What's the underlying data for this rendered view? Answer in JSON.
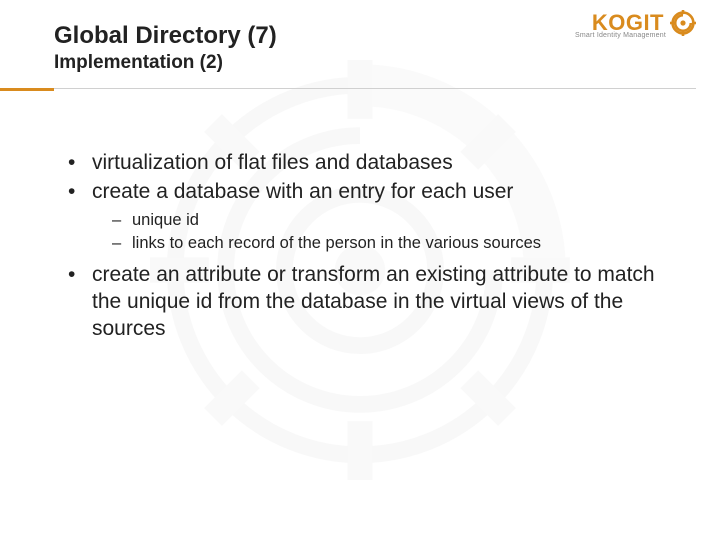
{
  "brand": {
    "name": "KOGIT",
    "tagline": "Smart Identity Management",
    "accent": "#d98b1e"
  },
  "header": {
    "title": "Global Directory (7)",
    "subtitle": "Implementation (2)"
  },
  "bullets": [
    {
      "text": "virtualization of flat files and databases"
    },
    {
      "text": "create a database with an entry for each user",
      "sub": [
        {
          "text": "unique id"
        },
        {
          "text": "links to each record of the person in the various sources"
        }
      ]
    },
    {
      "text": "create an attribute or transform an existing attribute to match the unique id from the database in the virtual views of the sources"
    }
  ]
}
